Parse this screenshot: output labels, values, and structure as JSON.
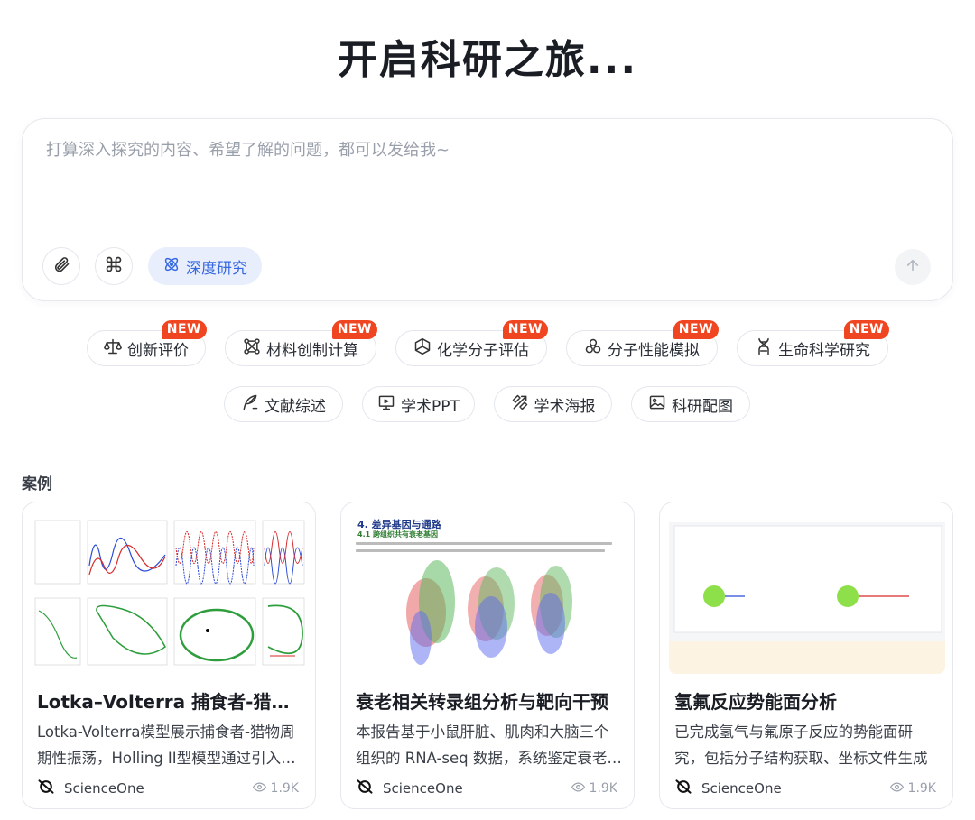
{
  "hero": {
    "title": "开启科研之旅..."
  },
  "composer": {
    "placeholder": "打算深入探究的内容、希望了解的问题，都可以发给我~",
    "deep_research_label": "深度研究"
  },
  "badge_new": "NEW",
  "chips_row1": [
    {
      "label": "创新评价",
      "icon": "scale-icon",
      "badge": true
    },
    {
      "label": "材料创制计算",
      "icon": "molecule-grid-icon",
      "badge": true
    },
    {
      "label": "化学分子评估",
      "icon": "hexagon-icon",
      "badge": true
    },
    {
      "label": "分子性能模拟",
      "icon": "three-circles-icon",
      "badge": true
    },
    {
      "label": "生命科学研究",
      "icon": "dna-icon",
      "badge": true
    }
  ],
  "chips_row2": [
    {
      "label": "文献综述",
      "icon": "quill-icon"
    },
    {
      "label": "学术PPT",
      "icon": "presentation-icon"
    },
    {
      "label": "学术海报",
      "icon": "poster-icon"
    },
    {
      "label": "科研配图",
      "icon": "image-icon"
    }
  ],
  "cases": {
    "section_label": "案例",
    "items": [
      {
        "title": "Lotka–Volterra 捕食者-猎物模型",
        "desc": "Lotka-Volterra模型展示捕食者-猎物周期性振荡，Holling II型模型通过引入饱和效应",
        "author": "ScienceOne",
        "views": "1.9K"
      },
      {
        "title": "衰老相关转录组分析与靶向干预",
        "desc": "本报告基于小鼠肝脏、肌肉和大脑三个组织的 RNA-seq 数据，系统鉴定衰老相关基因",
        "author": "ScienceOne",
        "views": "1.9K",
        "thumb": {
          "heading": "4. 差异基因与通路",
          "subheading": "4.1 跨组织共有衰老基因"
        }
      },
      {
        "title": "氢氟反应势能面分析",
        "desc": "已完成氢气与氟原子反应的势能面研究，包括分子结构获取、坐标文件生成",
        "author": "ScienceOne",
        "views": "1.9K"
      }
    ]
  },
  "colors": {
    "accent": "#3668e0",
    "badge": "#ef4520",
    "green": "#2e9e3c"
  }
}
